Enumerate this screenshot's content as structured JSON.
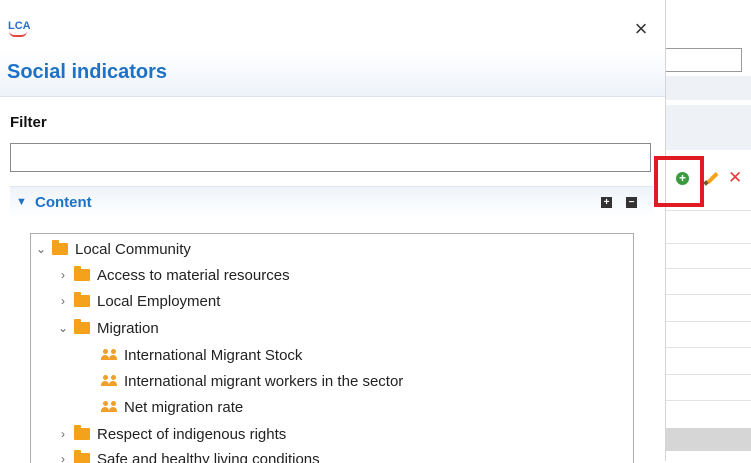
{
  "dialog": {
    "logo_text": "LCA",
    "title": "Social indicators",
    "filter_label": "Filter",
    "filter_value": "",
    "filter_placeholder": "",
    "section_title": "Content",
    "expand_all_label": "+",
    "collapse_all_label": "−"
  },
  "tree": {
    "items": [
      {
        "label": "Local Community",
        "expanded": true,
        "type": "folder"
      },
      {
        "label": "Access to material resources",
        "expanded": false,
        "type": "folder"
      },
      {
        "label": "Local Employment",
        "expanded": false,
        "type": "folder"
      },
      {
        "label": "Migration",
        "expanded": true,
        "type": "folder"
      },
      {
        "label": "International Migrant Stock",
        "type": "indicator"
      },
      {
        "label": "International migrant workers in the sector",
        "type": "indicator"
      },
      {
        "label": "Net migration rate",
        "type": "indicator"
      },
      {
        "label": "Respect of indigenous rights",
        "expanded": false,
        "type": "folder"
      },
      {
        "label": "Safe and healthy living conditions",
        "expanded": false,
        "type": "folder"
      }
    ]
  },
  "toolbar": {
    "add_icon": "add-circle-icon",
    "edit_icon": "pencil-icon",
    "delete_icon": "delete-x-icon"
  },
  "colors": {
    "accent": "#1d72c6",
    "folder": "#f4a21b",
    "highlight": "#e01b24",
    "add": "#3a9a3c",
    "delete": "#e43b3b"
  }
}
